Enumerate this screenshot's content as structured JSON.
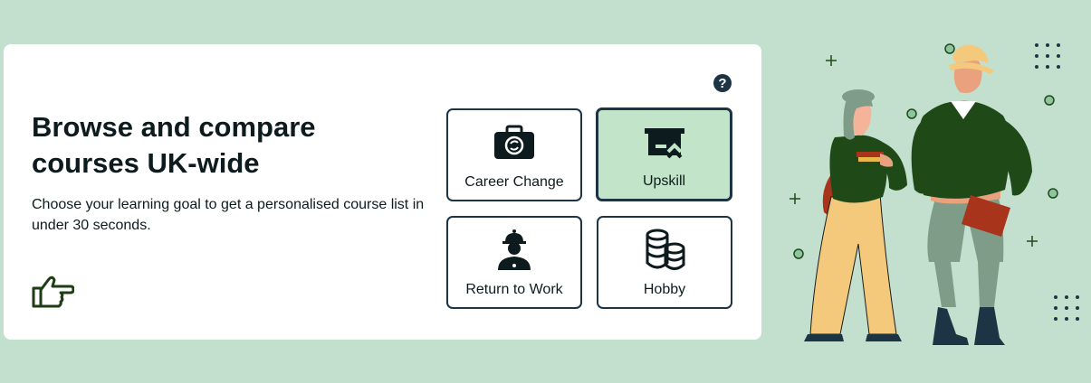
{
  "heading": "Browse and compare courses UK-wide",
  "subheading": "Choose your learning goal to get a personalised course list in under 30 seconds.",
  "help_glyph": "?",
  "goals": [
    {
      "label": "Career Change",
      "icon": "briefcase-icon",
      "selected": false
    },
    {
      "label": "Upskill",
      "icon": "upskill-icon",
      "selected": true
    },
    {
      "label": "Return to Work",
      "icon": "worker-icon",
      "selected": false
    },
    {
      "label": "Hobby",
      "icon": "coins-icon",
      "selected": false
    }
  ],
  "colors": {
    "background": "#c3e0cf",
    "card": "#ffffff",
    "tile_border": "#1d3445",
    "tile_selected": "#c2e4c8",
    "text": "#0d1b1e",
    "sweater": "#1f4a17"
  }
}
